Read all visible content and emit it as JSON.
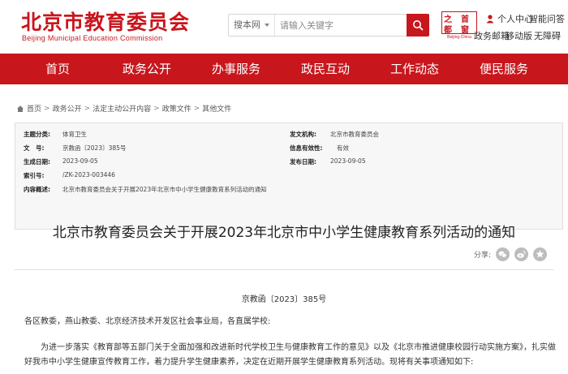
{
  "header": {
    "logo_cn": "北京市教育委员会",
    "logo_en": "Beijing Municipal Education Commission",
    "search_scope": "搜本网",
    "search_placeholder": "请输入关键字",
    "capital_logo": {
      "top_left": "之",
      "top_right": "首",
      "bottom_left": "都",
      "bottom_right": "窗",
      "sub": "Beijing-China"
    },
    "links": {
      "personal_center": "个人中心",
      "smart_qa": "智能问答",
      "weibo": "政务邮箱",
      "mobile": "移动版",
      "accessibility": "无障碍"
    }
  },
  "nav": {
    "items": [
      {
        "label": "首页"
      },
      {
        "label": "政务公开"
      },
      {
        "label": "办事服务"
      },
      {
        "label": "政民互动"
      },
      {
        "label": "工作动态"
      },
      {
        "label": "便民服务"
      }
    ]
  },
  "breadcrumb": {
    "items": [
      "首页",
      "政务公开",
      "法定主动公开内容",
      "政策文件",
      "其他文件"
    ],
    "sep": ">"
  },
  "info": {
    "topic_label": "主题分类:",
    "topic_value": "体育卫生",
    "publisher_label": "发文机构:",
    "publisher_value": "北京市教育委员会",
    "docno_label": "文　号:",
    "docno_value": "京教函〔2023〕385号",
    "status_label": "信息有效性:",
    "status_value": "有效",
    "created_label": "生成日期:",
    "created_value": "2023-09-05",
    "published_label": "发布日期:",
    "published_value": "2023-09-05",
    "index_label": "索引号:",
    "index_value": "/ZK-2023-003446",
    "summary_label": "内容概述:",
    "summary_value": "北京市教育委员会关于开展2023年北京市中小学生健康教育系列活动的通知"
  },
  "article": {
    "title": "北京市教育委员会关于开展2023年北京市中小学生健康教育系列活动的通知",
    "share_label": "分享:",
    "doc_no": "京教函〔2023〕385号",
    "salutation": "各区教委，燕山教委、北京经济技术开发区社会事业局，各直属学校:",
    "body_line1": "为进一步落实《教育部等五部门关于全面加强和改进新时代学校卫生与健康教育工作的意见》以及《北京市推进健康校园行动实施方案》，扎实做",
    "body_line2": "好我市中小学生健康宣传教育工作，着力提升学生健康素养，决定在近期开展学生健康教育系列活动。现将有关事项通知如下:"
  },
  "colors": {
    "brand_red": "#c8161d"
  }
}
